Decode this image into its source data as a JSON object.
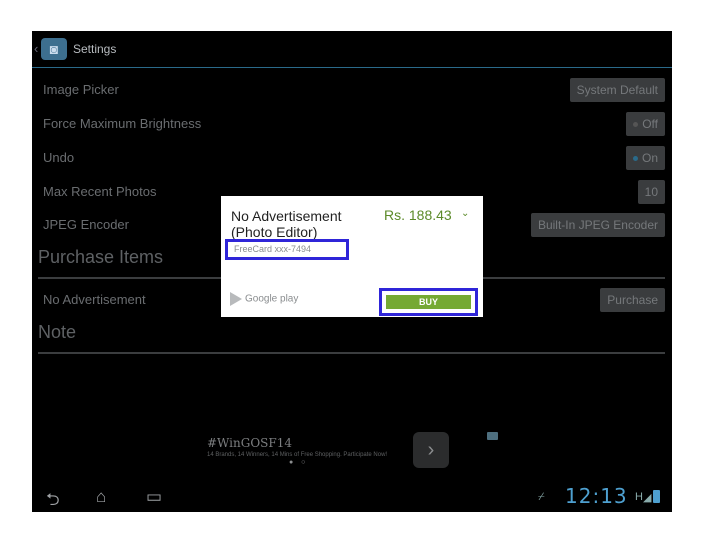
{
  "action_bar": {
    "title": "Settings",
    "icon": "camera-icon"
  },
  "settings": [
    {
      "label": "Image Picker",
      "value": "System Default"
    },
    {
      "label": "Force Maximum Brightness",
      "value": "Off"
    },
    {
      "label": "Undo",
      "value": "On"
    },
    {
      "label": "Max Recent Photos",
      "value": "10"
    },
    {
      "label": "JPEG Encoder",
      "value": "Built-In JPEG Encoder"
    }
  ],
  "purchase": {
    "heading": "Purchase Items",
    "item_label": "No Advertisement",
    "button": "Purchase"
  },
  "note": {
    "heading": "Note"
  },
  "ad": {
    "title": "#WinGOSF14",
    "subtitle": "14 Brands, 14 Winners, 14 Mins of Free Shopping. Participate Now!",
    "next": "›",
    "dots": "● ○"
  },
  "navbar": {
    "back": "⮌",
    "home": "⌂",
    "recents": "▭",
    "time": "12:13",
    "network": "H"
  },
  "dialog": {
    "title": "No Advertisement (Photo Editor)",
    "price": "Rs. 188.43",
    "chevron": "⌄",
    "payment": "FreeCard xxx-7494",
    "store": "Google play",
    "buy": "BUY"
  },
  "colors": {
    "accent": "#4ea0d0",
    "buy_green": "#75a933",
    "price_green": "#5b8a28",
    "highlight": "#2f25d8"
  }
}
